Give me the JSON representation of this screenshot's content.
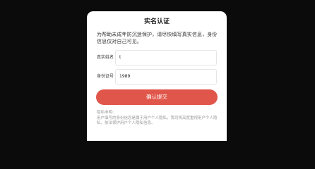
{
  "dialog": {
    "title": "实名认证",
    "notice": "为帮助未成年防沉迷保护，请尽快填写真实信息，身份信息仅对自己可见。",
    "fields": {
      "name": {
        "label": "真实姓名",
        "value": "t"
      },
      "id": {
        "label": "身份证号",
        "value": "1989"
      }
    },
    "submit_label": "确认提交",
    "privacy": {
      "title": "隐私申明:",
      "text": "用户填写的身份信息是属于用户个人隐私，我司将高度重视用户个人隐私，依法保护用户个人隐私信息。"
    }
  },
  "colors": {
    "accent": "#e0564a",
    "backdrop": "#0b0b0b"
  }
}
